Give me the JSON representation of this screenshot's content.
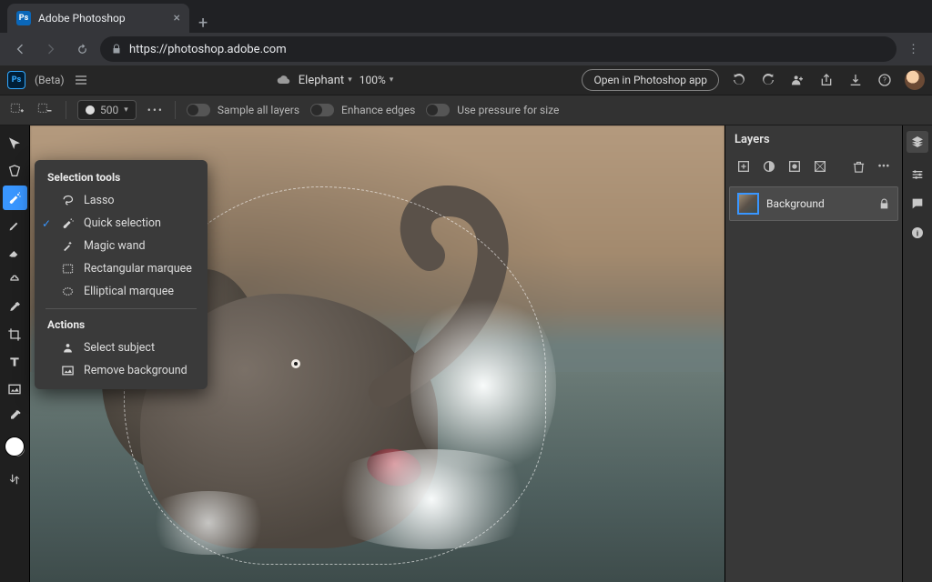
{
  "browser": {
    "tab_title": "Adobe Photoshop",
    "favicon_text": "Ps",
    "url": "https://photoshop.adobe.com"
  },
  "header": {
    "logo_text": "Ps",
    "beta_label": "(Beta)",
    "doc_name": "Elephant",
    "zoom": "100%",
    "open_app": "Open in Photoshop app"
  },
  "options_bar": {
    "brush_size": "500",
    "sample_all_layers": "Sample all layers",
    "enhance_edges": "Enhance edges",
    "use_pressure": "Use pressure for size"
  },
  "tools_popup": {
    "heading_selection": "Selection tools",
    "lasso": "Lasso",
    "quick_selection": "Quick selection",
    "magic_wand": "Magic wand",
    "rect_marquee": "Rectangular marquee",
    "ellipse_marquee": "Elliptical marquee",
    "heading_actions": "Actions",
    "select_subject": "Select subject",
    "remove_background": "Remove background"
  },
  "layers_panel": {
    "title": "Layers",
    "layer_0_name": "Background"
  }
}
